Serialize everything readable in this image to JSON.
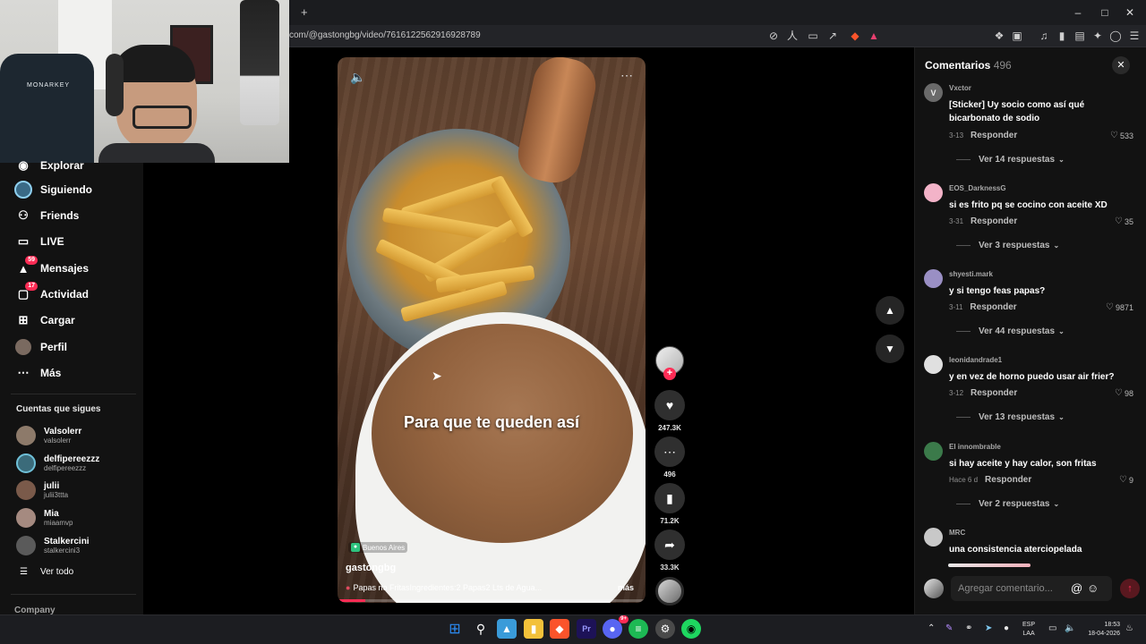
{
  "browser": {
    "url": "com/@gastongbg/video/7616122562916928789",
    "new_tab_icon": "plus-icon",
    "window_controls": [
      "minimize-icon",
      "maximize-icon",
      "close-icon"
    ]
  },
  "webcam": {
    "chair_brand": "MONARKEY"
  },
  "sidebar": {
    "nav": [
      {
        "label": "Explorar",
        "icon": "compass-icon"
      },
      {
        "label": "Siguiendo",
        "icon": "following-avatar-icon"
      },
      {
        "label": "Friends",
        "icon": "friends-icon"
      },
      {
        "label": "LIVE",
        "icon": "live-icon"
      },
      {
        "label": "Mensajes",
        "icon": "messages-icon",
        "badge": "59"
      },
      {
        "label": "Actividad",
        "icon": "activity-icon",
        "badge": "17"
      },
      {
        "label": "Cargar",
        "icon": "upload-icon"
      },
      {
        "label": "Perfil",
        "icon": "profile-avatar-icon"
      },
      {
        "label": "Más",
        "icon": "more-icon"
      }
    ],
    "following_title": "Cuentas que sigues",
    "following": [
      {
        "name": "Valsolerr",
        "user": "valsolerr",
        "color": "#8d7a6a"
      },
      {
        "name": "delfipereezzz",
        "user": "delfipereezzz",
        "color": "#3b6b7a"
      },
      {
        "name": "julii",
        "user": "julii3ttta",
        "color": "#7a5a4a"
      },
      {
        "name": "Mia",
        "user": "miaamvp",
        "color": "#a58a80"
      },
      {
        "name": "Stalkercini",
        "user": "stalkercini3",
        "color": "#5a5a5a"
      }
    ],
    "see_all": "Ver todo",
    "footer": "Company"
  },
  "video": {
    "caption": "Para que te queden así",
    "location": "Buenos Aires",
    "author": "gastongbg",
    "description": "Papas no FritasIngredientes:2 Papas2 Lts de Agua...",
    "more": "más",
    "progress_percent": 9
  },
  "actions": {
    "likes": "247.3K",
    "comments": "496",
    "saves": "71.2K",
    "shares": "33.3K"
  },
  "comments": {
    "title": "Comentarios",
    "count": "496",
    "input_placeholder": "Agregar comentario...",
    "reply_label": "Responder",
    "items": [
      {
        "user": "Vxctor",
        "avatar_letter": "V",
        "avatar_color": "#6a6a6a",
        "text": "[Sticker] Uy socio como así qué bicarbonato de sodio",
        "date": "3-13",
        "likes": "533",
        "replies": "Ver 14 respuestas"
      },
      {
        "user": "EOS_DarknessG",
        "avatar_letter": "",
        "avatar_color": "#f3b3c8",
        "text": "si es frito pq se cocino con aceite XD",
        "date": "3-31",
        "likes": "35",
        "replies": "Ver 3 respuestas"
      },
      {
        "user": "shyesti.mark",
        "avatar_letter": "",
        "avatar_color": "#9a8fc4",
        "text": "y si tengo feas papas?",
        "date": "3-11",
        "likes": "9871",
        "replies": "Ver 44 respuestas"
      },
      {
        "user": "leonidandrade1",
        "avatar_letter": "",
        "avatar_color": "#e0e0e0",
        "text": "y en vez de horno puedo usar air frier?",
        "date": "3-12",
        "likes": "98",
        "replies": "Ver 13 respuestas"
      },
      {
        "user": "El innombrable",
        "avatar_letter": "",
        "avatar_color": "#3b7a4a",
        "text": "si hay aceite y hay calor, son fritas",
        "date": "Hace 6 d",
        "likes": "9",
        "replies": "Ver 2 respuestas"
      },
      {
        "user": "MRC",
        "avatar_letter": "",
        "avatar_color": "#c8c8c8",
        "text": "una consistencia aterciopelada",
        "date": "",
        "likes": "",
        "replies": ""
      }
    ]
  },
  "taskbar": {
    "apps": [
      {
        "name": "windows-start-icon",
        "color": "#2b8cf5"
      },
      {
        "name": "search-icon",
        "color": "#ffffff"
      },
      {
        "name": "photos-icon",
        "color": "#3a9bd9"
      },
      {
        "name": "file-explorer-icon",
        "color": "#f3c13a"
      },
      {
        "name": "brave-browser-icon",
        "color": "#fb542b"
      },
      {
        "name": "premiere-icon",
        "color": "#1d1257"
      },
      {
        "name": "discord-icon",
        "color": "#5865f2",
        "badge": "9+"
      },
      {
        "name": "spotify-icon",
        "color": "#1db954"
      },
      {
        "name": "steam-icon",
        "color": "#4a4a4a"
      },
      {
        "name": "app-green-icon",
        "color": "#1ed760"
      }
    ],
    "lang_top": "ESP",
    "lang_bottom": "LAA",
    "time": "18:53",
    "date": "18-04-2026"
  }
}
